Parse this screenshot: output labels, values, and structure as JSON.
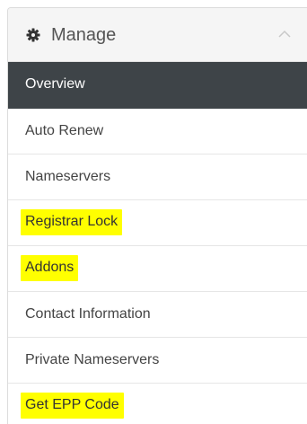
{
  "panel": {
    "title": "Manage",
    "header_icon": "gear-icon",
    "toggle_icon": "chevron-up-icon"
  },
  "menu": {
    "items": [
      {
        "label": "Overview",
        "active": true,
        "highlighted": false
      },
      {
        "label": "Auto Renew",
        "active": false,
        "highlighted": false
      },
      {
        "label": "Nameservers",
        "active": false,
        "highlighted": false
      },
      {
        "label": "Registrar Lock",
        "active": false,
        "highlighted": true
      },
      {
        "label": "Addons",
        "active": false,
        "highlighted": true
      },
      {
        "label": "Contact Information",
        "active": false,
        "highlighted": false
      },
      {
        "label": "Private Nameservers",
        "active": false,
        "highlighted": false
      },
      {
        "label": "Get EPP Code",
        "active": false,
        "highlighted": true
      }
    ]
  },
  "colors": {
    "active_bg": "#3e4448",
    "highlight": "#ffff00",
    "header_bg": "#f5f5f5"
  }
}
